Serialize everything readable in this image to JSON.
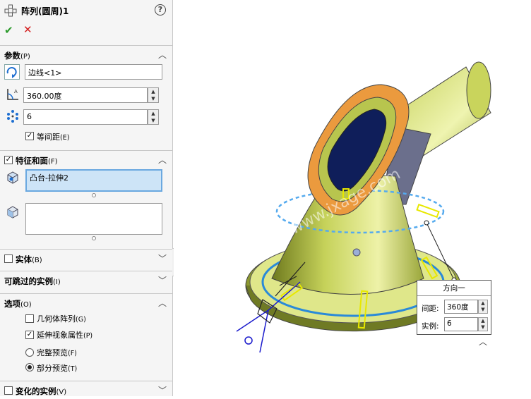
{
  "panel": {
    "title": "阵列(圆周)1",
    "ok_icon": "check-icon",
    "cancel_icon": "close-icon",
    "help_icon": "help-icon"
  },
  "params": {
    "header": "参数",
    "header_acc": "(P)",
    "edge_value": "边线<1>",
    "angle_value": "360.00度",
    "count_value": "6",
    "equal_spacing": "等间距",
    "equal_spacing_acc": "(E)"
  },
  "features": {
    "header": "特征和面",
    "header_acc": "(F)",
    "feature_item": "凸台-拉伸2"
  },
  "bodies": {
    "header": "实体",
    "header_acc": "(B)"
  },
  "skip": {
    "header": "可跳过的实例",
    "header_acc": "(I)"
  },
  "options": {
    "header": "选项",
    "header_acc": "(O)",
    "geometry_pattern": "几何体阵列",
    "geometry_pattern_acc": "(G)",
    "propagate_visual": "延伸视象属性",
    "propagate_visual_acc": "(P)",
    "full_preview": "完整预览",
    "full_preview_acc": "(F)",
    "partial_preview": "部分预览",
    "partial_preview_acc": "(T)"
  },
  "varying": {
    "header": "变化的实例",
    "header_acc": "(V)"
  },
  "callout": {
    "title": "方向一",
    "spacing_label": "间距:",
    "spacing_value": "360度",
    "instances_label": "实例:",
    "instances_value": "6"
  },
  "watermark": "机械 网 www.jxage.com",
  "colors": {
    "accent_blue": "#1e6fd1",
    "model_green": "#b9c94a",
    "model_orange": "#e89a3c"
  }
}
